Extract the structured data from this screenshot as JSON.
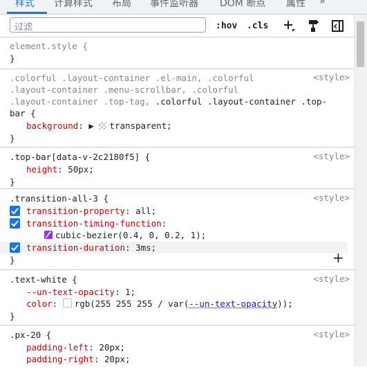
{
  "tabs": [
    "样式",
    "计算样式",
    "布局",
    "事件监听器",
    "DOM 断点",
    "属性"
  ],
  "more_tabs": "»",
  "toolbar": {
    "filter_placeholder": "过滤",
    "hov": ":hov",
    "cls": ".cls"
  },
  "rules": {
    "element_style": {
      "selector": "element.style {",
      "close": "}"
    },
    "colorful": {
      "sel1": ".colorful .layout-container .el-main, .colorful",
      "sel2": ".layout-container .menu-scrollbar, .colorful",
      "sel3a": ".layout-container .top-tag, ",
      "sel3b": ".colorful .layout-container .top-",
      "sel4": "bar {",
      "prop": "background",
      "value": "transparent;",
      "source": "<style>"
    },
    "topbar": {
      "selector": ".top-bar[data-v-2c2180f5] {",
      "prop": "height",
      "value": "50px;",
      "close": "}",
      "source": "<style>"
    },
    "transition": {
      "selector": ".transition-all-3 {",
      "p1": "transition-property",
      "v1": "all;",
      "p2": "transition-timing-function",
      "v2": "cubic-bezier(0.4, 0, 0.2, 1);",
      "p3": "transition-duration",
      "v3": "3ms;",
      "close": "}",
      "source": "<style>"
    },
    "textwhite": {
      "selector": ".text-white {",
      "p1": "--un-text-opacity",
      "v1": "1;",
      "p2": "color",
      "v2a": "rgb(255 255 255 / var(",
      "v2var": "--un-text-opacity",
      "v2b": "));",
      "close": "}",
      "source": "<style>"
    },
    "px20": {
      "selector": ".px-20 {",
      "p1": "padding-left",
      "v1": "20px;",
      "p2": "padding-right",
      "v2": "20px;",
      "source": "<style>"
    }
  },
  "colors": {
    "accent": "#1a73e8",
    "property": "#c80000",
    "bezier": "#9334e6"
  }
}
